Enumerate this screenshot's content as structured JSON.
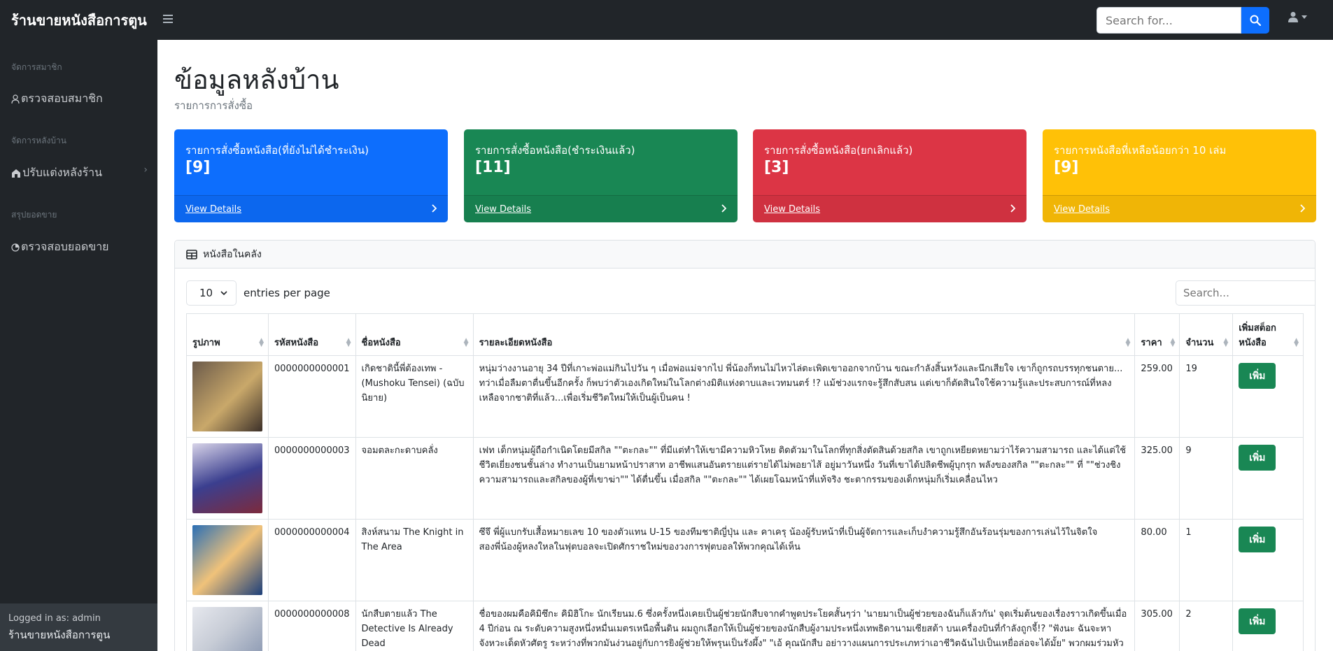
{
  "nav": {
    "brand": "ร้านขายหนังสือการตูน",
    "search_placeholder": "Search for...",
    "toggle_icon": "bars-icon",
    "search_icon": "search-icon",
    "user_icon": "user-icon"
  },
  "sidebar": {
    "sections": [
      {
        "heading": "จัดการสมาชิก",
        "item": "ตรวจสอบสมาชิก",
        "icon": "user-icon"
      },
      {
        "heading": "จัดการหลังบ้าน",
        "item": "ปรับแต่งหลังร้าน",
        "icon": "store-icon",
        "chevron": "›"
      },
      {
        "heading": "สรุปยอดขาย",
        "item": "ตรวจสอบยอดขาย",
        "icon": "chart-icon"
      }
    ],
    "footer_label": "Logged in as: admin",
    "footer_store": "ร้านขายหนังสือการตูน"
  },
  "page": {
    "title": "ข้อมูลหลังบ้าน",
    "breadcrumb": "รายการการสั่งซื้อ"
  },
  "cards": [
    {
      "title": "รายการสั่งซื้อหนังสือ(ที่ยังไม่ได้ชำระเงิน)",
      "count": "[9]",
      "link": "View Details",
      "color": "#0d6efd"
    },
    {
      "title": "รายการสั่งซื้อหนังสือ(ชำระเงินแล้ว)",
      "count": "[11]",
      "link": "View Details",
      "color": "#198754"
    },
    {
      "title": "รายการสั่งซื้อหนังสือ(ยกเลิกแล้ว)",
      "count": "[3]",
      "link": "View Details",
      "color": "#dc3545"
    },
    {
      "title": "รายการหนังสือที่เหลือน้อยกว่า 10 เล่ม",
      "count": "[9]",
      "link": "View Details",
      "color": "#ffc107"
    }
  ],
  "inventory": {
    "header": "หนังสือในคลัง",
    "entries_value": "10",
    "entries_label": "entries per page",
    "search_placeholder": "Search...",
    "columns": [
      "รูปภาพ",
      "รหัสหนังสือ",
      "ชื่อหนังสือ",
      "รายละเอียดหนังสือ",
      "ราคา",
      "จำนวน",
      "เพิ่มสต็อกหนังสือ"
    ],
    "rows": [
      {
        "code": "0000000000001",
        "name": "เกิดชาตินี้พี่ต้องเทพ - (Mushoku Tensei) (ฉบับนิยาย)",
        "desc": "หนุ่มว่างงานอายุ 34 ปีที่เกาะพ่อแม่กินไปวัน ๆ เมื่อพ่อแม่จากไป พี่น้องก็ทนไม่ไหวไล่ตะเพิดเขาออกจากบ้าน ขณะกำลังสิ้นหวังและนึกเสียใจ เขาก็ถูกรถบรรทุกชนตาย... ทว่าเมื่อลืมตาตื่นขึ้นอีกครั้ง ก็พบว่าตัวเองเกิดใหม่ในโลกต่างมิติแห่งดาบและเวทมนตร์ !? แม้ช่วงแรกจะรู้สึกสับสน แต่เขาก็ตัดสินใจใช้ความรู้และประสบการณ์ที่หลงเหลือจากชาติที่แล้ว...เพื่อเริ่มชีวิตใหม่ให้เป็นผู้เป็นคน !",
        "price": "259.00",
        "qty": "19",
        "button": "เพิ่ม",
        "cover": [
          "#6b5a4a",
          "#c9a86a"
        ]
      },
      {
        "code": "0000000000003",
        "name": "จอมตละกะดาบคลั่ง",
        "desc": "เฟท เด็กหนุ่มผู้ถือกำเนิดโดยมีสกิล \"\"ตะกละ\"\" ที่มีแต่ทำให้เขามีความหิวโหย ติดตัวมาในโลกที่ทุกสิ่งตัดสินด้วยสกิล เขาถูกเหยียดหยามว่าไร้ความสามารถ และได้แต่ใช้ชีวิตเยี่ยงชนชั้นล่าง ทำงานเป็นยามหน้าปราสาท อาชีพแสนอันตรายแต่รายได้ไม่พอยาไส้ อยู่มาวันหนึ่ง วันที่เขาได้ปลิดชีพผู้บุกรุก พลังของสกิล \"\"ตะกละ\"\" ที่ \"\"ช่วงชิงความสามารถและสกิลของผู้ที่เขาฆ่า\"\" ได้ตื่นขึ้น เมื่อสกิล \"\"ตะกละ\"\" ได้เผยโฉมหน้าที่แท้จริง ชะตากรรมของเด็กหนุ่มก็เริ่มเคลื่อนไหว",
        "price": "325.00",
        "qty": "9",
        "button": "เพิ่ม",
        "cover": [
          "#3b3f8f",
          "#d7d3e8"
        ]
      },
      {
        "code": "0000000000004",
        "name": "สิงห์สนาม The Knight in The Area",
        "desc": "ซึจึ พี่ผู้แบกรับเสื้อหมายเลข 10 ของตัวแทน U-15 ของทีมชาติญี่ปุ่น และ คาเครุ น้องผู้รับหน้าที่เป็นผู้จัดการและเก็บงำความรู้สึกอันร้อนรุ่มของการเล่นไว้ในจิตใจ สองพี่น้องผู้หลงใหลในฟุตบอลจะเปิดศักราชใหม่ของวงการฟุตบอลให้พวกคุณได้เห็น",
        "price": "80.00",
        "qty": "1",
        "button": "เพิ่ม",
        "cover": [
          "#2a6fb5",
          "#f0c27a"
        ]
      },
      {
        "code": "0000000000008",
        "name": "นักสืบตายแล้ว The Detective Is Already Dead",
        "desc": "ชื่อของผมคือคิมิซึกะ คิมิฮิโกะ นักเรียนม.6 ซึ่งครั้งหนึ่งเคยเป็นผู้ช่วยนักสืบจากคำพูดประโยคสั้นๆว่า 'นายมาเป็นผู้ช่วยของฉันก็แล้วกัน' จุดเริ่มต้นของเรื่องราวเกิดขึ้นเมื่อ 4 ปีก่อน ณ ระดับความสูงหนึ่งหมื่นเมตรเหนือพื้นดิน ผมถูกเลือกให้เป็นผู้ช่วยของนักสืบผู้งามประหนึ่งเทพธิดานามเซียสต้า บนเครื่องบินที่กำลังถูกจี้!? \"ฟังนะ ฉันจะหาจังหวะเด็ดหัวศัตรู ระหว่างที่พวกมันง่วนอยู่กับการยิงผู้ช่วยให้พรุนเป็นรังผึ้ง\" \"เอ้ คุณนักสืบ อย่าวางแผนการประเภทว่าเอาชีวิตฉันไปเป็นเหยื่อล่อจะได้มั้ย\" พวกผมร่วมหัว",
        "price": "305.00",
        "qty": "2",
        "button": "เพิ่ม",
        "cover": [
          "#c7ccd6",
          "#7a8aa8"
        ]
      }
    ]
  }
}
